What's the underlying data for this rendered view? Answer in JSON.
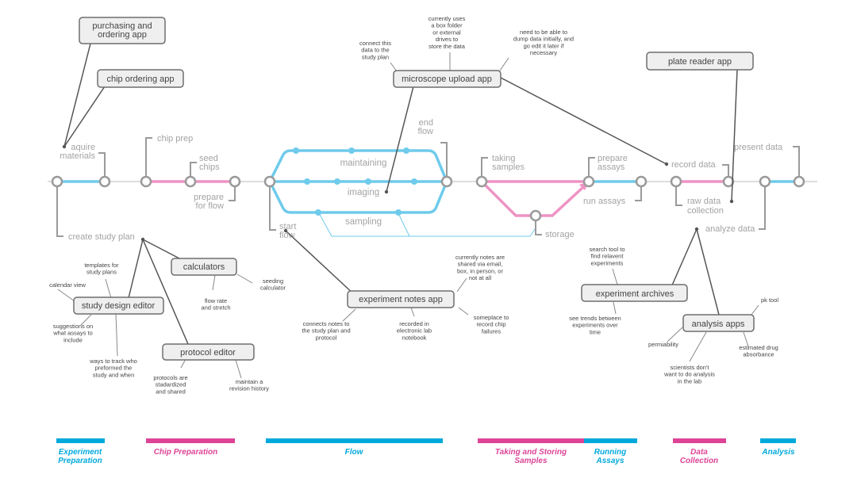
{
  "colors": {
    "blue": "#6fcbeb",
    "pink": "#ee93c4",
    "phase_blue": "#00a9dc",
    "phase_pink": "#dd4496",
    "node_stroke": "#9a9a9a",
    "track_grey": "#dddddd",
    "leader": "#9a9a9a",
    "connector": "#555555",
    "box_fill": "#efefef",
    "box_stroke": "#6e6e6e"
  },
  "stops": {
    "aquire_materials": "aquire\nmaterials",
    "create_study_plan": "create study plan",
    "chip_prep": "chip prep",
    "seed_chips": "seed\nchips",
    "prepare_for_flow": "prepare\nfor flow",
    "start_flow": "start\nflow",
    "end_flow": "end\nflow",
    "taking_samples": "taking\nsamples",
    "storage": "storage",
    "prepare_assays": "prepare\nassays",
    "run_assays": "run assays",
    "record_data": "record data",
    "raw_data_collection": "raw data\ncollection",
    "analyze_data": "analyze data",
    "present_data": "present data"
  },
  "branches": {
    "maintaining": "maintaining",
    "imaging": "imaging",
    "sampling": "sampling"
  },
  "apps": {
    "purchasing": "purchasing and\nordering app",
    "chip_ordering": "chip ordering app",
    "microscope": "microscope upload app",
    "plate_reader": "plate reader app",
    "study_design": "study design editor",
    "calculators": "calculators",
    "protocol": "protocol editor",
    "experiment_notes": "experiment notes app",
    "experiment_archives": "experiment archives",
    "analysis_apps": "analysis apps"
  },
  "notes": {
    "microscope_connect": "connect this\ndata to the\nstudy plan",
    "microscope_box": "currently uses\na box folder\nor external\ndrives to\nstore the data",
    "microscope_dump": "need to be able to\ndump data initially, and\ngo edit it later if\nnecessary",
    "templates": "templates for\nstudy plans",
    "calendar": "calendar view",
    "suggestions": "suggestions on\nwhat assays to\ninclude",
    "track_who": "ways to track who\npreformed the\nstudy and when",
    "seeding_calc": "seeding\ncalculator",
    "flow_rate": "flow rate\nand stretch",
    "protocols_std": "protocols are\nstadardized\nand shared",
    "revision": "maintain a\nrevision history",
    "notes_shared": "currently notes are\nshared via email,\nbox, in person, or\nnot at all",
    "notes_connect": "connects notes to\nthe study plan and\nprotocol",
    "notes_eln": "recorded in\nelectronic lab\nnotebook",
    "notes_failures": "someplace to\nrecord chip\nfailures",
    "search_tool": "search tool to\nfind relavent\nexperiments",
    "trends": "see trends between\nexperiments over\ntime",
    "pk_tool": "pk tool",
    "permiability": "permiability",
    "drug_absorbance": "estimated drug\nabsorbance",
    "scientists": "scientists don't\nwant to do analysis\nin the lab"
  },
  "phases": [
    {
      "label": "Experiment\nPreparation",
      "color": "blue"
    },
    {
      "label": "Chip Preparation",
      "color": "pink"
    },
    {
      "label": "Flow",
      "color": "blue"
    },
    {
      "label": "Taking and Storing\nSamples",
      "color": "pink"
    },
    {
      "label": "Running\nAssays",
      "color": "blue"
    },
    {
      "label": "Data\nCollection",
      "color": "pink"
    },
    {
      "label": "Analysis",
      "color": "blue"
    }
  ]
}
